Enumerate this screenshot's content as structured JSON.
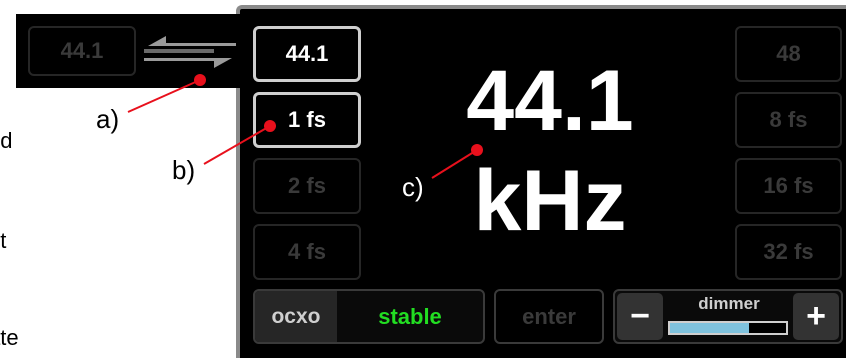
{
  "left_text": [
    "ed",
    "/.",
    "et",
    "ate"
  ],
  "popup": {
    "rate": "44.1"
  },
  "rates": {
    "current": "44.1",
    "r48": "48"
  },
  "multipliers": {
    "m1": "1 fs",
    "m2": "2 fs",
    "m4": "4 fs",
    "m8": "8 fs",
    "m16": "16 fs",
    "m32": "32 fs"
  },
  "display": {
    "value": "44.1",
    "unit": "kHz"
  },
  "callouts": {
    "a": "a)",
    "b": "b)",
    "c": "c)"
  },
  "ocxo": {
    "label": "ocxo",
    "status": "stable"
  },
  "enter_label": "enter",
  "dimmer": {
    "label": "dimmer",
    "minus": "−",
    "plus": "+",
    "level": 0.68
  },
  "colors": {
    "panel": "#000000",
    "bezel": "#8a8a8a",
    "stable": "#22dd22",
    "dimmer_fill": "#7fc2dd",
    "callout_dot": "#e8101c"
  }
}
